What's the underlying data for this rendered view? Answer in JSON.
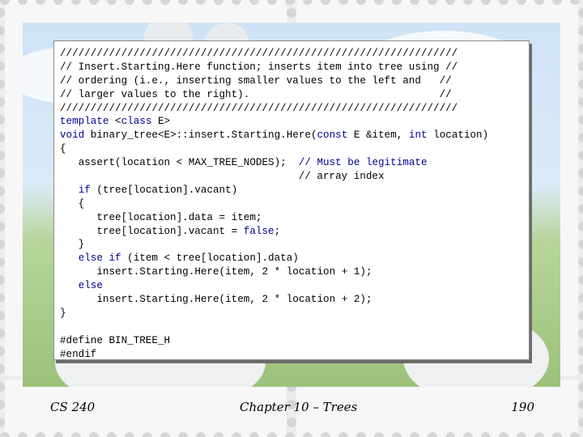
{
  "code": {
    "lines": [
      "/////////////////////////////////////////////////////////////////",
      "// Insert.Starting.Here function; inserts item into tree using //",
      "// ordering (i.e., inserting smaller values to the left and   //",
      "// larger values to the right).                               //",
      "/////////////////////////////////////////////////////////////////",
      "template <class E>",
      "void binary_tree<E>::insert.Starting.Here(const E &item, int location)",
      "{",
      "   assert(location < MAX_TREE_NODES);  // Must be legitimate",
      "                                       // array index",
      "   if (tree[location].vacant)",
      "   {",
      "      tree[location].data = item;",
      "      tree[location].vacant = false;",
      "   }",
      "   else if (item < tree[location].data)",
      "      insert.Starting.Here(item, 2 * location + 1);",
      "   else",
      "      insert.Starting.Here(item, 2 * location + 2);",
      "}",
      "",
      "#define BIN_TREE_H",
      "#endif"
    ]
  },
  "footer": {
    "course": "CS 240",
    "chapter": "Chapter 10 – Trees",
    "page_number": "190"
  },
  "colors": {
    "keyword": "#000090",
    "comment": "#000090",
    "text": "#000000"
  }
}
